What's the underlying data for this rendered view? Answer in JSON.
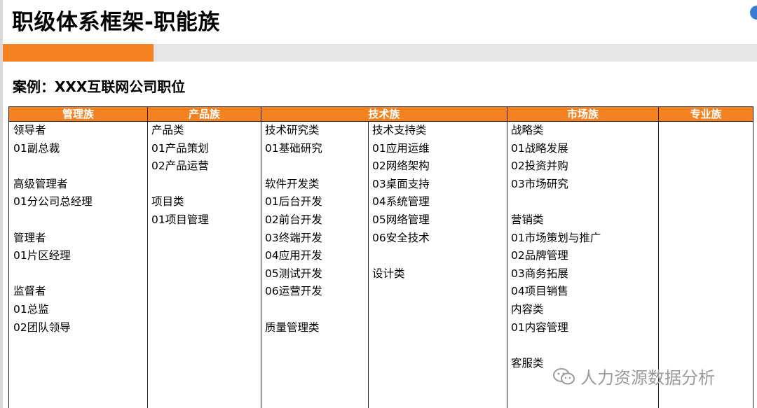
{
  "title": "职级体系框架-职能族",
  "progress": 0.2,
  "subtitle": "案例：XXX互联网公司职位",
  "table": {
    "headers": [
      "管理族",
      "产品族",
      "技术族",
      "市场族",
      "专业族"
    ],
    "columns": [
      [
        "领导者",
        "01副总裁",
        "",
        "高级管理者",
        "01分公司总经理",
        "",
        "管理者",
        "01片区经理",
        "",
        "监督者",
        "01总监",
        "02团队领导"
      ],
      [
        "产品类",
        "01产品策划",
        "02产品运营",
        "",
        "项目类",
        "01项目管理"
      ],
      [
        "技术研究类",
        "01基础研究",
        "",
        "软件开发类",
        "01后台开发",
        "02前台开发",
        "03终端开发",
        "04应用开发",
        "05测试开发",
        "06运营开发",
        "",
        "质量管理类"
      ],
      [
        "技术支持类",
        "01应用运维",
        "02网络架构",
        "03桌面支持",
        "04系统管理",
        "05网络管理",
        "06安全技术",
        "",
        "设计类"
      ],
      [
        "战略类",
        "01战略发展",
        "02投资并购",
        "03市场研究",
        "",
        "营销类",
        "01市场策划与推广",
        "02品牌管理",
        "03商务拓展",
        "04项目销售",
        "内容类",
        "01内容管理",
        "",
        "客服类"
      ],
      []
    ]
  },
  "watermark": "人力资源数据分析",
  "colors": {
    "accent": "#f58220",
    "track": "#e5e5e5",
    "header_text": "#ffffff"
  },
  "icons": {
    "corner": "round-blue-icon",
    "watermark": "wechat-icon"
  }
}
